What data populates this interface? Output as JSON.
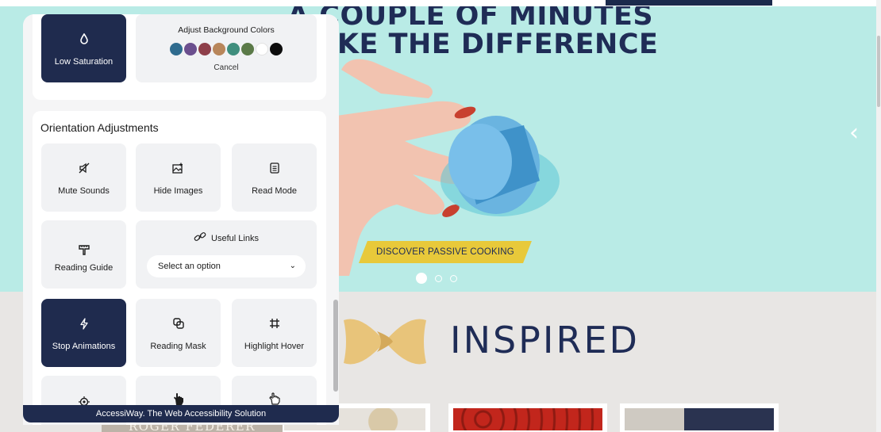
{
  "hero": {
    "title_line1": "A COUPLE OF MINUTES",
    "title_line2": "MAKE THE DIFFERENCE",
    "cta": "DISCOVER PASSIVE COOKING",
    "prev_icon": "chevron-left-icon",
    "slides": 3,
    "active_slide": 1
  },
  "inspired": {
    "title": "INSPIRED"
  },
  "federer_text": "ROGER FEDERER",
  "panel": {
    "low_saturation": {
      "label": "Low Saturation",
      "icon": "droplet-icon"
    },
    "background_colors": {
      "title": "Adjust Background Colors",
      "swatches": [
        "#2f6b8e",
        "#6b4f8e",
        "#8e3f4a",
        "#b8865a",
        "#3f8e7d",
        "#5b7a48",
        "#ffffff",
        "#0d0d0d"
      ],
      "cancel": "Cancel"
    },
    "orientation": {
      "title": "Orientation Adjustments",
      "mute_sounds": {
        "label": "Mute Sounds",
        "icon": "volume-mute-icon"
      },
      "hide_images": {
        "label": "Hide Images",
        "icon": "image-off-icon"
      },
      "read_mode": {
        "label": "Read Mode",
        "icon": "document-icon"
      },
      "reading_guide": {
        "label": "Reading Guide",
        "icon": "ruler-icon"
      },
      "useful_links": {
        "label": "Useful Links",
        "icon": "link-icon",
        "select_value": "Select an option"
      },
      "stop_animations": {
        "label": "Stop Animations",
        "icon": "lightning-icon"
      },
      "reading_mask": {
        "label": "Reading Mask",
        "icon": "mask-icon"
      },
      "highlight_hover": {
        "label": "Highlight Hover",
        "icon": "hash-frame-icon"
      }
    },
    "footer": "AccessiWay. The Web Accessibility Solution"
  },
  "colors": {
    "navy": "#1f2b4e",
    "hero_bg": "#b9ebe6",
    "cta": "#e8c93a"
  }
}
